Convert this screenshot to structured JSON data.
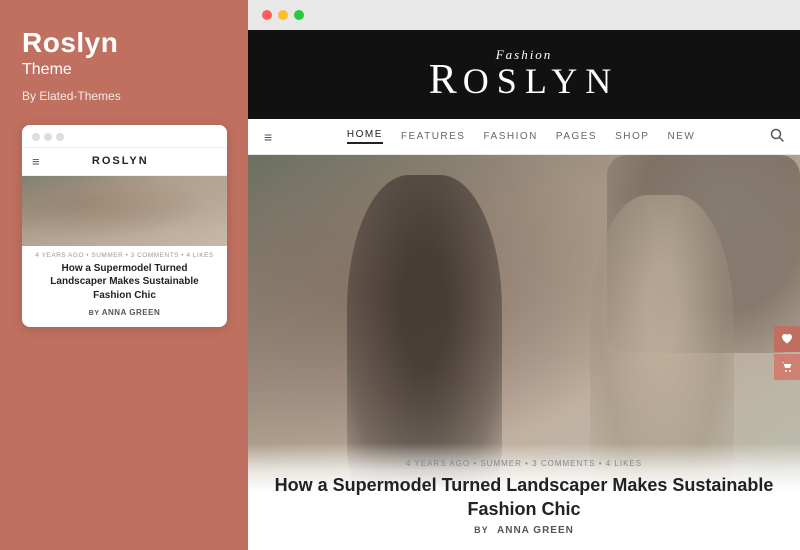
{
  "left": {
    "title": "Roslyn",
    "subtitle": "Theme",
    "author": "By Elated-Themes",
    "mobile_preview": {
      "dots": [
        "dot1",
        "dot2",
        "dot3"
      ],
      "logo": "ROSLYN",
      "article_meta": "4 YEARS AGO • SUMMER • 3 COMMENTS • 4 LIKES",
      "article_title": "How a Supermodel Turned Landscaper Makes Sustainable Fashion Chic",
      "byline_pre": "by",
      "author_name": "ANNA GREEN"
    }
  },
  "browser": {
    "dots": [
      "red",
      "yellow",
      "green"
    ],
    "header": {
      "script_text": "Fashion",
      "logo_text": "ROSLYN"
    },
    "nav": {
      "hamburger": "≡",
      "links": [
        {
          "label": "HOME",
          "active": true
        },
        {
          "label": "FEATURES",
          "active": false
        },
        {
          "label": "FASHION",
          "active": false
        },
        {
          "label": "PAGES",
          "active": false
        },
        {
          "label": "SHOP",
          "active": false
        },
        {
          "label": "NEW",
          "active": false
        }
      ],
      "search_icon": "🔍"
    },
    "article": {
      "meta": "4 YEARS AGO • SUMMER • 3 COMMENTS • 4 LIKES",
      "title": "How a Supermodel Turned Landscaper Makes Sustainable Fashion Chic",
      "byline_pre": "by",
      "author": "ANNA GREEN"
    },
    "side_icons": {
      "heart": "♥",
      "cart": "🛒"
    }
  }
}
